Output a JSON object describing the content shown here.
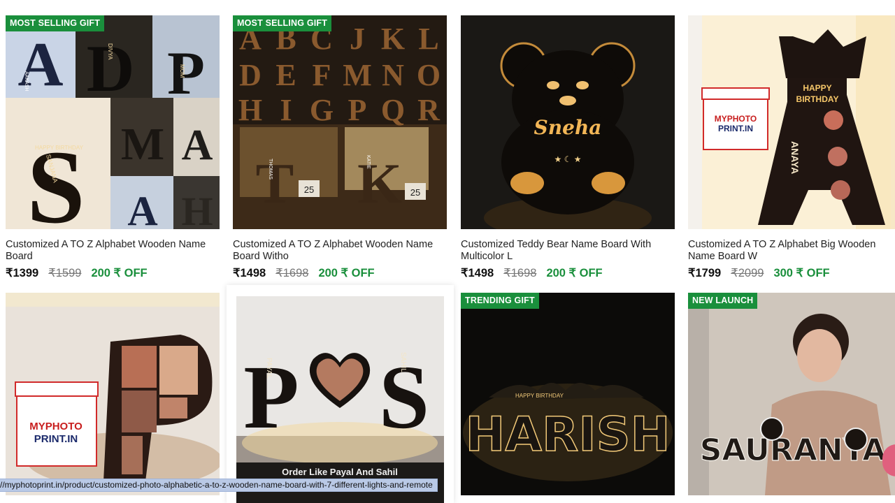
{
  "products": [
    {
      "badge": "MOST SELLING GIFT",
      "title": "Customized A TO Z Alphabet Wooden Name Board",
      "price": "₹1399",
      "mrp": "₹1599",
      "off": "200 ₹ OFF"
    },
    {
      "badge": "MOST SELLING GIFT",
      "title": "Customized A TO Z Alphabet Wooden Name Board Witho",
      "price": "₹1498",
      "mrp": "₹1698",
      "off": "200 ₹ OFF"
    },
    {
      "badge": "",
      "title": "Customized Teddy Bear Name Board With Multicolor L",
      "price": "₹1498",
      "mrp": "₹1698",
      "off": "200 ₹ OFF"
    },
    {
      "badge": "",
      "title": "Customized A TO Z Alphabet Big Wooden Name Board W",
      "price": "₹1799",
      "mrp": "₹2099",
      "off": "300 ₹ OFF"
    }
  ],
  "row2": [
    {
      "badge": ""
    },
    {
      "badge": "",
      "caption": "Order Like Payal And Sahil"
    },
    {
      "badge": "TRENDING GIFT"
    },
    {
      "badge": "NEW LAUNCH"
    }
  ],
  "image_text": {
    "p1_letters": [
      "A",
      "D",
      "P",
      "S",
      "M",
      "A",
      "A",
      "H"
    ],
    "p1_names": [
      "AAKASH",
      "DIVYA",
      "MOM",
      "SANJANA"
    ],
    "p1_happy": "HAPPY BIRTHDAY",
    "p2_grid": [
      "A",
      "B",
      "C",
      "J",
      "K",
      "L",
      "D",
      "E",
      "F",
      "M",
      "N",
      "O",
      "H",
      "I",
      "G",
      "P",
      "Q",
      "R"
    ],
    "p2_letters": [
      "T",
      "K"
    ],
    "p2_names": [
      "THOMAS",
      "KATIE"
    ],
    "p2_clock": "25",
    "p3_name": "Sneha",
    "p4_happy": "HAPPY",
    "p4_birthday": "BIRTHDAY",
    "p4_name": "ANAYA",
    "logo_line1": "MYPHOTO",
    "logo_line2": "PRINT.IN",
    "p6_letters": [
      "P",
      "S"
    ],
    "p6_names": [
      "PAYAL",
      "SAHIL"
    ],
    "p7_happy": "HAPPY BIRTHDAY",
    "p7_name": "HARISH",
    "p8_name": "SAURANYA"
  },
  "status_url": "//myphotoprint.in/product/customized-photo-alphabetic-a-to-z-wooden-name-board-with-7-different-lights-and-remote",
  "colors": {
    "badge_green": "#1a8f3c",
    "off_green": "#1a8f3c",
    "status_bar": "#b9c9e6"
  }
}
